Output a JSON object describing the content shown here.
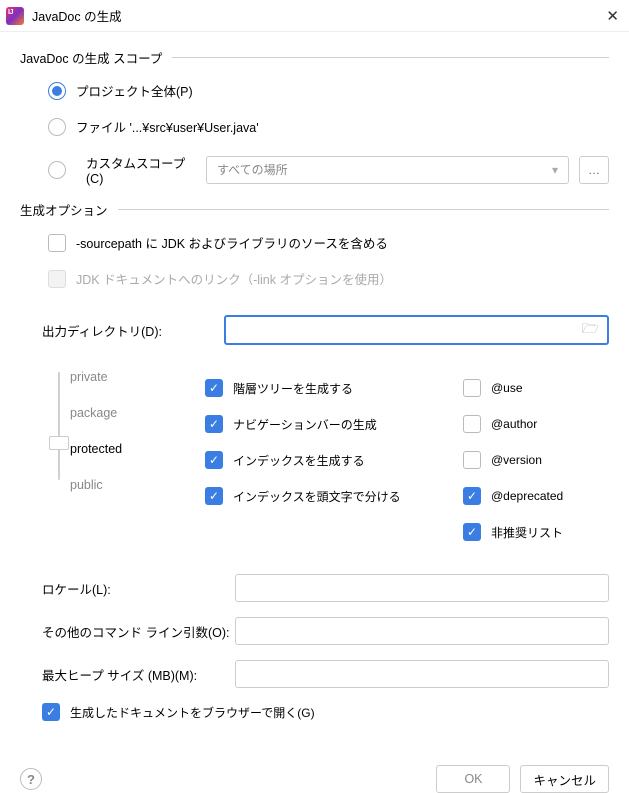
{
  "window": {
    "title": "JavaDoc の生成"
  },
  "scope": {
    "section_title": "JavaDoc の生成 スコープ",
    "wholeProject": "プロジェクト全体(P)",
    "file": "ファイル '...¥src¥user¥User.java'",
    "custom": "カスタムスコープ(C)",
    "select_placeholder": "すべての場所"
  },
  "gen": {
    "section_title": "生成オプション",
    "sourcepath": "-sourcepath に JDK およびライブラリのソースを含める",
    "jdklink": "JDK ドキュメントへのリンク（-link オプションを使用）",
    "outdir_label": "出力ディレクトリ(D):",
    "visibility": {
      "private": "private",
      "package": "package",
      "protected": "protected",
      "public": "public"
    },
    "options_left": {
      "tree": "階層ツリーを生成する",
      "nav": "ナビゲーションバーの生成",
      "index": "インデックスを生成する",
      "split": "インデックスを頭文字で分ける"
    },
    "options_right": {
      "use": "@use",
      "author": "@author",
      "version": "@version",
      "deprecated": "@deprecated",
      "deprecated_list": "非推奨リスト"
    },
    "locale_label": "ロケール(L):",
    "cmd_label": "その他のコマンド ライン引数(O):",
    "heap_label": "最大ヒープ サイズ (MB)(M):",
    "open_browser": "生成したドキュメントをブラウザーで開く(G)"
  },
  "buttons": {
    "ok": "OK",
    "cancel": "キャンセル"
  }
}
